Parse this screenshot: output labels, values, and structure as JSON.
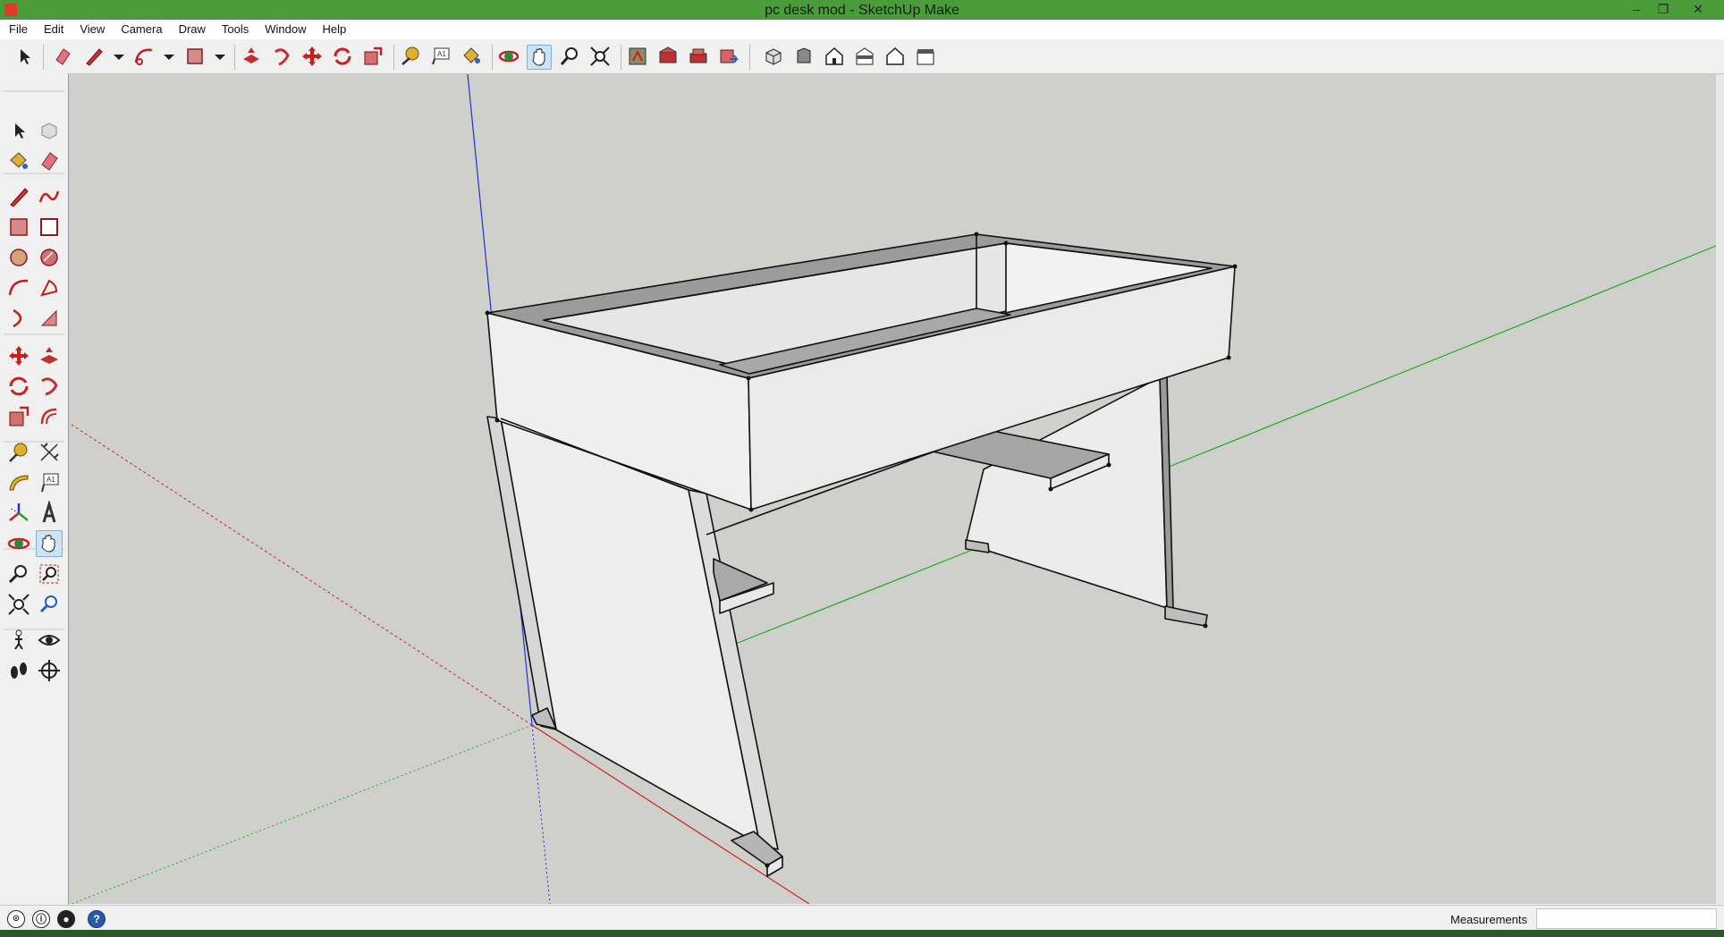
{
  "window": {
    "title": "pc desk mod - SketchUp Make",
    "minimize_glyph": "–",
    "maximize_glyph": "❐",
    "close_glyph": "✕"
  },
  "menu": {
    "items": [
      "File",
      "Edit",
      "View",
      "Camera",
      "Draw",
      "Tools",
      "Window",
      "Help"
    ]
  },
  "toolbar": {
    "icons": [
      "select-icon",
      "eraser-icon",
      "pencil-icon",
      "line-dropdown-icon",
      "arc-icon",
      "arc-dropdown-icon",
      "rectangle-icon",
      "rectangle-dropdown-icon",
      "push-pull-icon",
      "follow-me-icon",
      "move-icon",
      "rotate-icon",
      "scale-icon",
      "tape-measure-icon",
      "text-icon",
      "paint-bucket-icon",
      "orbit-icon",
      "pan-icon",
      "zoom-icon",
      "zoom-extents-icon",
      "model-info-icon",
      "3d-warehouse-icon",
      "get-models-icon",
      "share-model-icon",
      "iso-view-icon",
      "top-view-icon",
      "front-view-icon",
      "right-view-icon",
      "back-view-icon",
      "left-view-icon"
    ],
    "active": "pan-icon"
  },
  "left_toolbar": {
    "icons": [
      "select-icon",
      "component-icon",
      "paint-bucket-icon",
      "eraser-icon",
      "line-icon",
      "freehand-icon",
      "rectangle-icon",
      "rotated-rectangle-icon",
      "circle-icon",
      "polygon-icon",
      "arc-icon",
      "pie-icon",
      "two-point-arc-icon",
      "three-point-arc-icon",
      "move-icon",
      "push-pull-icon",
      "rotate-icon",
      "follow-me-icon",
      "scale-icon",
      "offset-icon",
      "tape-measure-icon",
      "dimension-icon",
      "protractor-icon",
      "text-icon",
      "axes-icon",
      "3d-text-icon",
      "orbit-icon",
      "pan-icon",
      "zoom-icon",
      "zoom-window-icon",
      "zoom-extents-icon",
      "previous-view-icon",
      "position-camera-icon",
      "look-around-icon",
      "walk-icon",
      "section-plane-icon"
    ],
    "active": "pan-icon"
  },
  "statusbar": {
    "measurements_label": "Measurements",
    "measurements_value": "",
    "icons": [
      "geo-location-icon",
      "credits-icon",
      "user-icon",
      "help-icon"
    ],
    "help_glyph": "?"
  },
  "colors": {
    "titlebar": "#4a9c3b",
    "viewport_bg": "#cfcfcb",
    "axis_red": "#cc2222",
    "axis_green": "#22aa22",
    "axis_blue": "#2233cc",
    "face_light": "#efefef",
    "face_shade": "#b8b8b8",
    "active_tool": "#cde4f7"
  }
}
